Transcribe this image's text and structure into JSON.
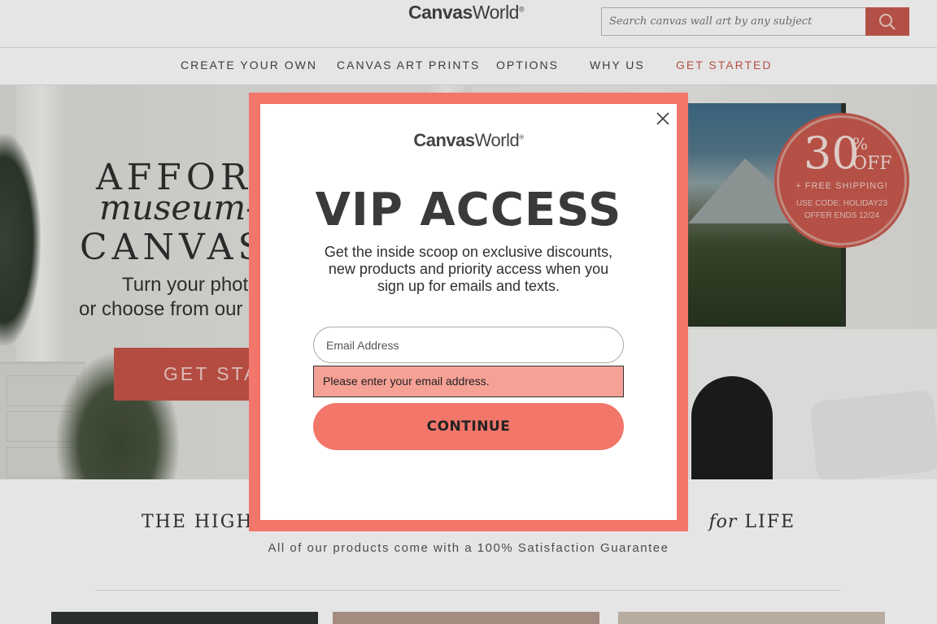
{
  "header": {
    "logo_bold": "Canvas",
    "logo_light": "World",
    "logo_mark": "®",
    "search_placeholder": "Search canvas wall art by any subject",
    "search_icon": "magnifier-icon"
  },
  "nav": {
    "items": [
      {
        "label": "CREATE YOUR OWN"
      },
      {
        "label": "CANVAS ART PRINTS"
      },
      {
        "label": "OPTIONS"
      },
      {
        "label": "WHY US"
      },
      {
        "label": "GET STARTED"
      }
    ]
  },
  "hero": {
    "title_line1": "AFFORDA",
    "title_line2": "museum-q",
    "title_line3": "CANVAS P",
    "sub_line1": "Turn your photo",
    "sub_line2": "or choose from our h",
    "cta_label": "GET STAR"
  },
  "promo": {
    "percent": "30",
    "percent_sign": "%",
    "off": "OFF",
    "shipping": "+ FREE SHIPPING!",
    "code": "USE CODE: HOLIDAY23",
    "ends": "OFFER ENDS 12/24"
  },
  "bottom": {
    "tagline_start": "THE HIGH",
    "tagline_italic": "for",
    "tagline_end": "LIFE",
    "guarantee": "All of our products come with a 100% Satisfaction Guarantee"
  },
  "modal": {
    "logo_bold": "Canvas",
    "logo_light": "World",
    "logo_mark": "®",
    "title": "VIP ACCESS",
    "description": "Get the inside scoop on exclusive discounts, new products and priority access when you sign up for emails and texts.",
    "email_placeholder": "Email Address",
    "error_message": "Please enter your email address.",
    "continue_label": "CONTINUE",
    "close_icon": "close-icon"
  },
  "colors": {
    "accent": "#c85a4e",
    "modal_frame": "#f2766a",
    "error_bg": "#f6a196"
  }
}
